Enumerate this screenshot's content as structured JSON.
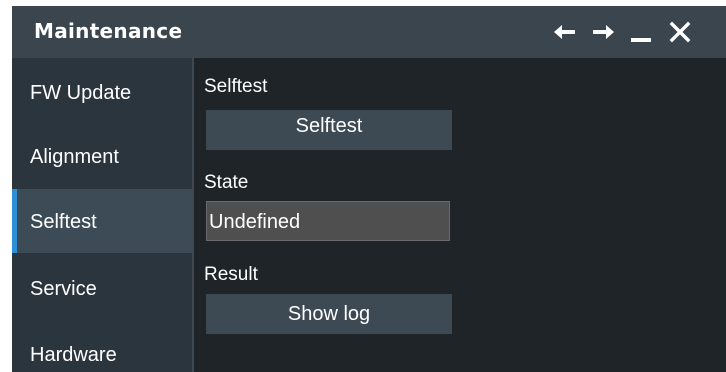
{
  "window": {
    "title": "Maintenance",
    "controls": [
      {
        "name": "back-arrow-icon"
      },
      {
        "name": "forward-arrow-icon"
      },
      {
        "name": "minimize-icon"
      },
      {
        "name": "close-icon"
      }
    ]
  },
  "sidebar": {
    "items": [
      {
        "label": "FW Update",
        "active": false
      },
      {
        "label": "Alignment",
        "active": false
      },
      {
        "label": "Selftest",
        "active": true
      },
      {
        "label": "Service",
        "active": false
      },
      {
        "label": "Hardware",
        "active": false
      }
    ]
  },
  "main": {
    "selftest_label": "Selftest",
    "selftest_button": "Selftest",
    "state_label": "State",
    "state_value": "Undefined",
    "result_label": "Result",
    "show_log_button": "Show log"
  },
  "colors": {
    "accent": "#2d8fd6",
    "titlebar": "#3a454d",
    "sidebar": "#2b353d",
    "content": "#1e2428"
  }
}
